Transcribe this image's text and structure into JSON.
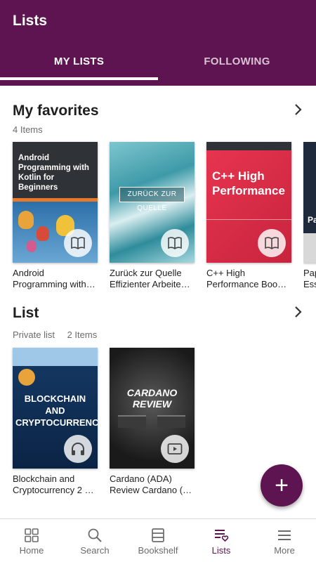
{
  "appbar": {
    "title": "Lists",
    "tabs": [
      {
        "label": "MY LISTS",
        "active": true
      },
      {
        "label": "FOLLOWING",
        "active": false
      }
    ]
  },
  "sections": [
    {
      "title": "My favorites",
      "meta": [
        "4 Items"
      ],
      "books": [
        {
          "title": "Android Programming with…",
          "cover_title": "Android Programming with Kotlin for Beginners",
          "badge": "book-icon"
        },
        {
          "title": "Zurück zur Quelle Effizienter Arbeite…",
          "cover_title": "ZURÜCK ZUR QUELLE",
          "badge": "book-icon"
        },
        {
          "title": "C++ High Performance Boo…",
          "cover_title": "C++ High Performance",
          "badge": "book-icon"
        },
        {
          "title": "Pap Ess",
          "cover_title": "Pa",
          "badge": ""
        }
      ]
    },
    {
      "title": "List",
      "meta": [
        "Private list",
        "2 Items"
      ],
      "books": [
        {
          "title": "Blockchain and Cryptocurrency 2 …",
          "cover_title": "BLOCKCHAIN AND CRYPTOCURRENCY",
          "badge": "headphones-icon"
        },
        {
          "title": "Cardano (ADA) Review Cardano (…",
          "cover_title": "CARDANO REVIEW",
          "badge": "play-icon"
        }
      ]
    }
  ],
  "fab": {
    "label": "+"
  },
  "bottom_nav": [
    {
      "label": "Home",
      "icon": "home-icon"
    },
    {
      "label": "Search",
      "icon": "search-icon"
    },
    {
      "label": "Bookshelf",
      "icon": "bookshelf-icon"
    },
    {
      "label": "Lists",
      "icon": "lists-icon",
      "active": true
    },
    {
      "label": "More",
      "icon": "menu-icon"
    }
  ],
  "colors": {
    "primary": "#5e1450",
    "text": "#1f1f1f",
    "muted": "#6b6b6b"
  }
}
